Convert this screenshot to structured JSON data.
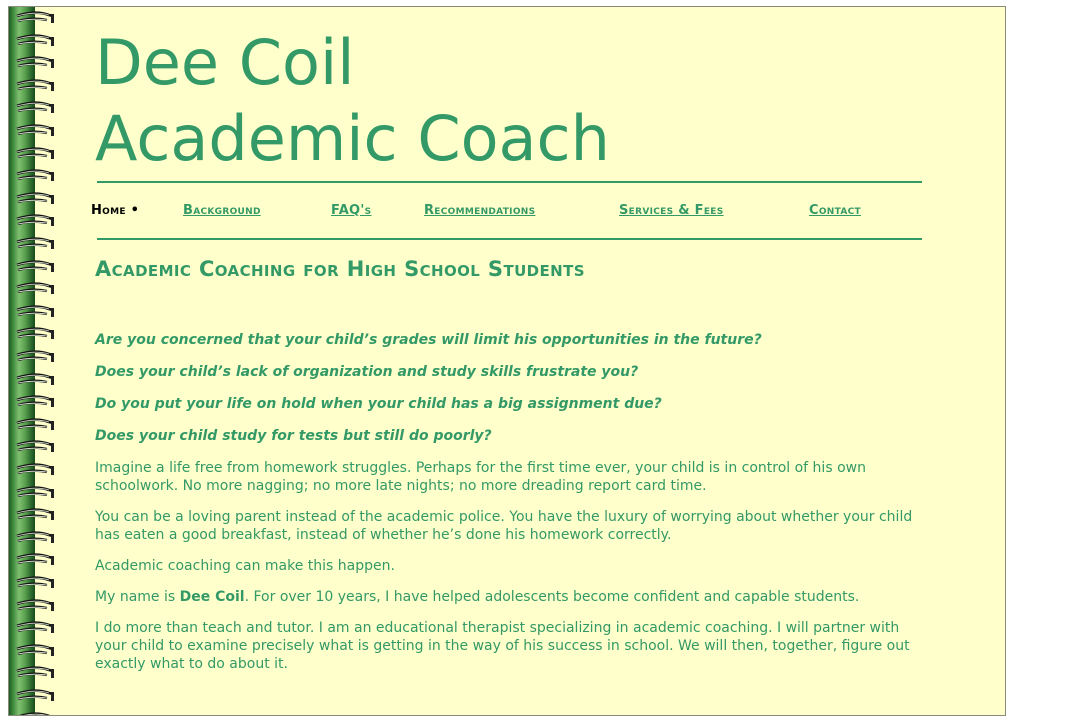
{
  "site": {
    "title_line1": "Dee Coil",
    "title_line2": "Academic Coach"
  },
  "nav": {
    "home": "Home",
    "home_marker": "•",
    "items": [
      "Background",
      "FAQ's",
      "Recommendations",
      "Services & Fees",
      "Contact"
    ]
  },
  "main": {
    "heading": "Academic Coaching for High School Students",
    "questions": [
      "Are you concerned that your child’s grades will limit his opportunities in the future?",
      "Does your child’s lack of organization and study skills frustrate you?",
      "Do you put your life on hold when your child has a big assignment due?",
      "Does your child study for tests but still do poorly?"
    ],
    "para1": "Imagine a life free from homework struggles.  Perhaps for the first time ever, your child is in control of his own schoolwork.  No more nagging; no more late nights; no more dreading report card time.",
    "para2": "You can be a loving parent instead of the academic police.  You have the luxury of worrying about whether your child has eaten a good breakfast, instead of whether he’s done his homework correctly.",
    "para3": "Academic coaching can make this happen.",
    "para4_prefix": "My name is ",
    "para4_name": "Dee Coil",
    "para4_suffix": ". For over 10 years, I have helped adolescents become confident and capable students.",
    "para5": "I do more than teach and tutor. I am an educational therapist specializing in academic coaching. I will partner with your child to examine precisely what is getting in the way of his success in school. We will then, together, figure out exactly what to do about it."
  },
  "colors": {
    "accent": "#339966",
    "page_bg": "#ffffcc",
    "spiral": "#2d6b2e"
  }
}
